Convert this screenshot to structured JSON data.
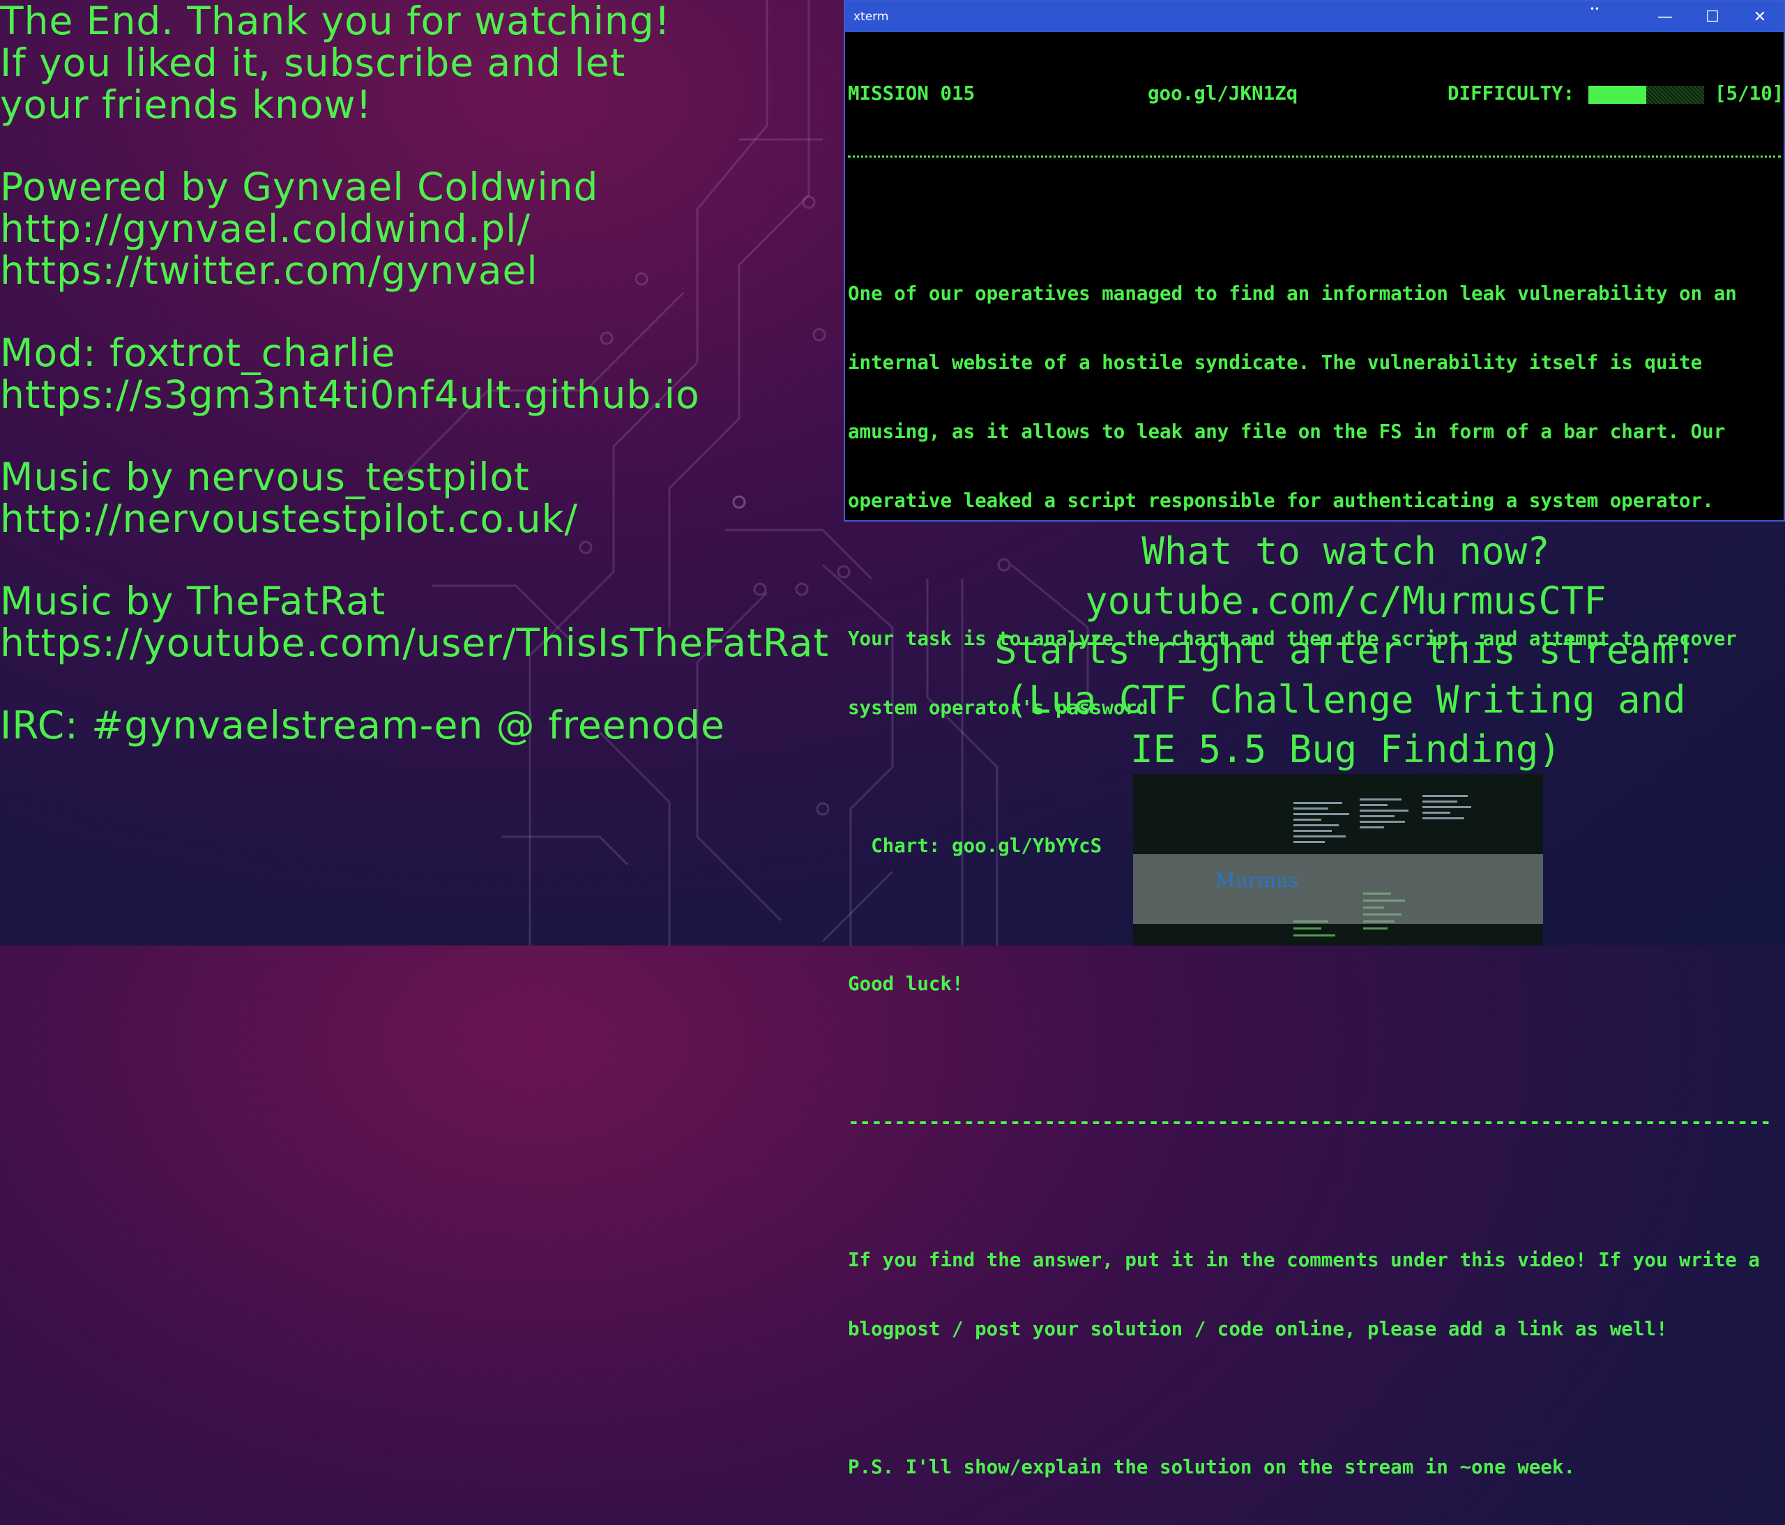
{
  "credits": {
    "lines": [
      "The End. Thank you for watching!",
      "If you liked it, subscribe and let",
      "your friends know!",
      "Powered by Gynvael Coldwind",
      "http://gynvael.coldwind.pl/",
      "https://twitter.com/gynvael",
      "Mod: foxtrot_charlie",
      "https://s3gm3nt4ti0nf4ult.github.io",
      "Music by nervous_testpilot",
      "http://nervoustestpilot.co.uk/",
      "Music by TheFatRat",
      "https://youtube.com/user/ThisIsTheFatRat",
      "IRC: #gynvaelstream-en @ freenode"
    ]
  },
  "xterm": {
    "title": "xterm",
    "buttons": {
      "minimize": "—",
      "maximize": "☐",
      "close": "✕"
    },
    "header": {
      "mission": "MISSION 015",
      "url": "goo.gl/JKN1Zq",
      "difficulty_label": "DIFFICULTY:",
      "difficulty_value": "[5/10]",
      "difficulty_fraction": 0.5
    },
    "body": [
      "One of our operatives managed to find an information leak vulnerability on an",
      "internal website of a hostile syndicate. The vulnerability itself is quite",
      "amusing, as it allows to leak any file on the FS in form of a bar chart. Our",
      "operative leaked a script responsible for authenticating a system operator.",
      "",
      "Your task is to analyze the chart and then the script, and attempt to recover",
      "system operator's password.",
      "",
      "  Chart: goo.gl/YbYYcS",
      "",
      "Good luck!",
      ""
    ],
    "separator": "--------------------------------------------------------------------------------",
    "footer": [
      "",
      "If you find the answer, put it in the comments under this video! If you write a",
      "blogpost / post your solution / code online, please add a link as well!",
      "",
      "P.S. I'll show/explain the solution on the stream in ~one week."
    ]
  },
  "promo": {
    "lines": [
      "What to watch now?",
      "youtube.com/c/MurmusCTF",
      "Starts right after this stream!",
      "(Lua CTF Challenge Writing and",
      "IE 5.5 Bug Finding)"
    ]
  },
  "thumbnail": {
    "title": "Murmus"
  }
}
